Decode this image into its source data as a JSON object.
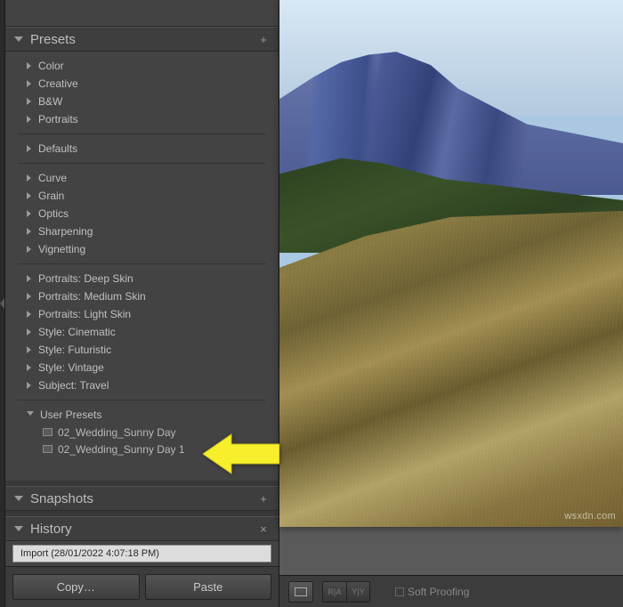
{
  "panels": {
    "presets": {
      "title": "Presets",
      "groups": [
        {
          "name": "group1",
          "folders": [
            {
              "label": "Color"
            },
            {
              "label": "Creative"
            },
            {
              "label": "B&W"
            },
            {
              "label": "Portraits"
            }
          ]
        },
        {
          "name": "group2",
          "folders": [
            {
              "label": "Defaults"
            }
          ]
        },
        {
          "name": "group3",
          "folders": [
            {
              "label": "Curve"
            },
            {
              "label": "Grain"
            },
            {
              "label": "Optics"
            },
            {
              "label": "Sharpening"
            },
            {
              "label": "Vignetting"
            }
          ]
        },
        {
          "name": "group4",
          "folders": [
            {
              "label": "Portraits: Deep Skin"
            },
            {
              "label": "Portraits: Medium Skin"
            },
            {
              "label": "Portraits: Light Skin"
            },
            {
              "label": "Style: Cinematic"
            },
            {
              "label": "Style: Futuristic"
            },
            {
              "label": "Style: Vintage"
            },
            {
              "label": "Subject: Travel"
            }
          ]
        }
      ],
      "user_presets": {
        "label": "User Presets",
        "items": [
          {
            "label": "02_Wedding_Sunny Day"
          },
          {
            "label": "02_Wedding_Sunny Day 1"
          }
        ]
      }
    },
    "snapshots": {
      "title": "Snapshots"
    },
    "history": {
      "title": "History",
      "entries": [
        {
          "label": "Import (28/01/2022 4:07:18 PM)"
        }
      ]
    }
  },
  "buttons": {
    "copy": "Copy…",
    "paste": "Paste"
  },
  "toolbar": {
    "soft_proofing": "Soft Proofing",
    "ra": "R|A",
    "yy": "Y|Y"
  },
  "watermark": "wsxdn.com",
  "icons": {
    "plus": "+",
    "close": "×"
  }
}
